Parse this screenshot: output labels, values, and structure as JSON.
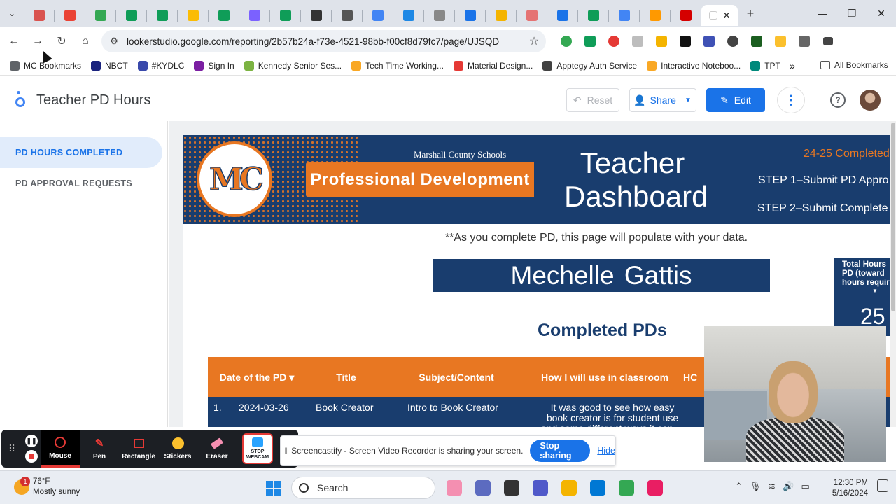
{
  "browser": {
    "url": "lookerstudio.google.com/reporting/2b57b24a-f73e-4521-98bb-f00cf8d79fc7/page/UJSQD",
    "tab_favicon_colors": [
      "#d9534f",
      "#ea4335",
      "#34a853",
      "#0f9d58",
      "#0f9d58",
      "#fbbc04",
      "#0f9d58",
      "#7b61ff",
      "#0f9d58",
      "#333333",
      "#555555",
      "#4285f4",
      "#1e88e5",
      "#888888",
      "#1a73e8",
      "#f4b400",
      "#e57373",
      "#1a73e8",
      "#0f9d58",
      "#4285f4",
      "#ff9900",
      "#d50000"
    ],
    "bookmarks": [
      {
        "label": "MC Bookmarks",
        "color": "#5f6368"
      },
      {
        "label": "NBCT",
        "color": "#1a237e"
      },
      {
        "label": "#KYDLC",
        "color": "#3949ab"
      },
      {
        "label": "Sign In",
        "color": "#7b1fa2"
      },
      {
        "label": "Kennedy Senior Ses...",
        "color": "#7cb342"
      },
      {
        "label": "Tech Time Working...",
        "color": "#f9a825"
      },
      {
        "label": "Material Design...",
        "color": "#e53935"
      },
      {
        "label": "Apptegy Auth Service",
        "color": "#424242"
      },
      {
        "label": "Interactive Noteboo...",
        "color": "#f9a825"
      },
      {
        "label": "TPT",
        "color": "#00897b"
      }
    ],
    "all_bookmarks": "All Bookmarks"
  },
  "looker": {
    "report_title": "Teacher PD Hours",
    "reset_label": "Reset",
    "share_label": "Share",
    "edit_label": "Edit",
    "nav": [
      "PD HOURS COMPLETED",
      "PD APPROVAL REQUESTS"
    ]
  },
  "banner": {
    "logo_text": "MC",
    "org": "Marshall County Schools",
    "program": "Professional Development",
    "dashboard_title": "Teacher Dashboard",
    "year_label": "24-25 Completed",
    "step1": "STEP 1–Submit PD Appro",
    "step2": "STEP 2–Submit Complete"
  },
  "report": {
    "note": "**As you complete PD, this page will populate with your data.",
    "teacher_name": "Mechelle  Gattis",
    "total_label": "Total Hours\nPD (toward\nhours requir",
    "total_value": "25",
    "completed_title": "Completed PDs",
    "table": {
      "headers": [
        "Date of the PD ▾",
        "Title",
        "Subject/Content",
        "How I will use in classroom",
        "HC"
      ],
      "rows": [
        {
          "index": "1.",
          "date": "2024-03-26",
          "title": "Book Creator",
          "subject": "Intro to Book Creator",
          "use": "It was good to see how easy book creator is for student use and some different ways it can ... dents and ... rs."
        }
      ]
    }
  },
  "screencastify": {
    "tools": [
      "Mouse",
      "Pen",
      "Rectangle",
      "Stickers",
      "Eraser"
    ],
    "webcam_label": "STOP WEBCAM",
    "notice": "Screencastify - Screen Video Recorder is sharing your screen.",
    "stop_sharing": "Stop sharing",
    "hide": "Hide"
  },
  "taskbar": {
    "weather_temp": "76°F",
    "weather_desc": "Mostly sunny",
    "weather_badge": "1",
    "search_label": "Search",
    "time": "12:30 PM",
    "date": "5/16/2024",
    "app_colors": [
      "#f48fb1",
      "#5c6bc0",
      "#333333",
      "#5059c9",
      "#f4b400",
      "#0078d4",
      "#34a853",
      "#e91e63"
    ]
  }
}
